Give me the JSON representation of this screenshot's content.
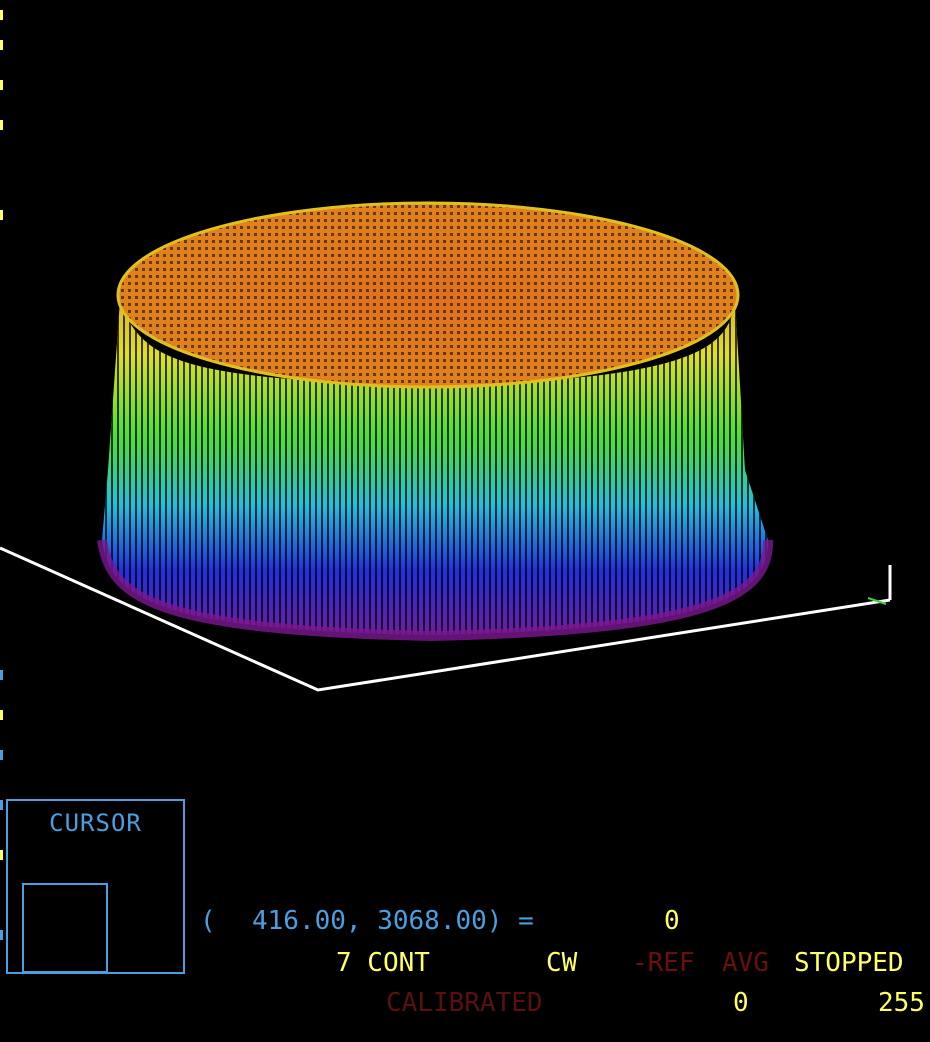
{
  "cursor_panel": {
    "title": "CURSOR"
  },
  "readout": {
    "open_paren": "(",
    "coords": "416.00, 3068.00) =",
    "value": "0"
  },
  "status": {
    "mode": "7 CONT",
    "cw": "CW",
    "ref": "-REF",
    "avg": "AVG",
    "state": "STOPPED"
  },
  "calibration": {
    "label": "CALIBRATED",
    "min": "0",
    "max": "255"
  },
  "colors": {
    "ui_blue": "#4a9fe0",
    "text_yellow": "#ffff66",
    "inactive_red": "#6b0e0e",
    "axis_white": "#ffffff",
    "background": "#000000"
  },
  "plot": {
    "type": "3d-wireframe-surface",
    "shape": "flat-top cylinder",
    "colormap": [
      "#6a1a8a",
      "#2030e0",
      "#20c0e0",
      "#40e040",
      "#e0e020",
      "#e09020",
      "#e07020"
    ]
  }
}
